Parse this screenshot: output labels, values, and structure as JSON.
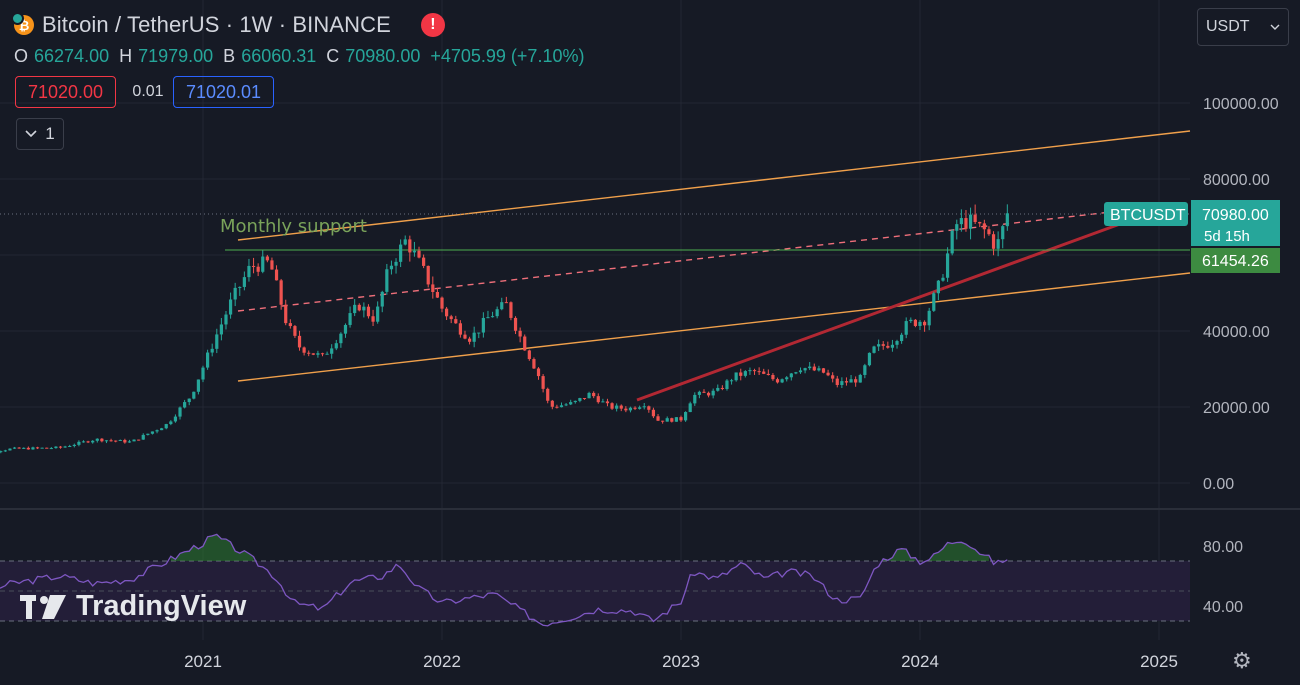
{
  "header": {
    "title": "Bitcoin / TetherUS · 1W · BINANCE",
    "logo_glyph": "₿",
    "alert_glyph": "!",
    "ohlc": [
      {
        "key": "O",
        "value": "66274.00"
      },
      {
        "key": "H",
        "value": "71979.00"
      },
      {
        "key": "B",
        "value": "66060.31"
      },
      {
        "key": "C",
        "value": "70980.00"
      }
    ],
    "change": "+4705.99 (+7.10%)",
    "sell_price": "71020.00",
    "spread": "0.01",
    "buy_price": "71020.01",
    "indicators_count": "1"
  },
  "toolbar": {
    "currency": "USDT"
  },
  "branding": {
    "name": "TradingView"
  },
  "colors": {
    "background": "#161a25",
    "up": "#26a69a",
    "down": "#ef5350",
    "channel": "#f0a04b",
    "trend": "#b22833",
    "support": "#4caf50",
    "rsi": "#7e57c2"
  },
  "chart_data": {
    "type": "candlestick",
    "symbol": "BTCUSDT",
    "last_price": "70980.00",
    "countdown": "5d 15h",
    "support_price": "61454.26",
    "annotation": "Monthly support",
    "ylim": [
      0,
      110000
    ],
    "y_ticks": [
      "100000.00",
      "80000.00",
      "40000.00",
      "20000.00",
      "0.00"
    ],
    "x_ticks": [
      "2021",
      "2022",
      "2023",
      "2024",
      "2025"
    ],
    "weekly_close_path": [
      [
        2020.0,
        7300
      ],
      [
        2020.2,
        9000
      ],
      [
        2020.4,
        9300
      ],
      [
        2020.55,
        11500
      ],
      [
        2020.7,
        10800
      ],
      [
        2020.85,
        15500
      ],
      [
        2020.95,
        23000
      ],
      [
        2021.05,
        38000
      ],
      [
        2021.12,
        48000
      ],
      [
        2021.2,
        57000
      ],
      [
        2021.28,
        58000
      ],
      [
        2021.35,
        42000
      ],
      [
        2021.4,
        36000
      ],
      [
        2021.5,
        33000
      ],
      [
        2021.58,
        40000
      ],
      [
        2021.65,
        47000
      ],
      [
        2021.72,
        43000
      ],
      [
        2021.78,
        57000
      ],
      [
        2021.85,
        64000
      ],
      [
        2021.92,
        56000
      ],
      [
        2022.0,
        46000
      ],
      [
        2022.05,
        42000
      ],
      [
        2022.12,
        38000
      ],
      [
        2022.2,
        44000
      ],
      [
        2022.27,
        47000
      ],
      [
        2022.33,
        38000
      ],
      [
        2022.4,
        29000
      ],
      [
        2022.45,
        20000
      ],
      [
        2022.55,
        21000
      ],
      [
        2022.62,
        23500
      ],
      [
        2022.7,
        20000
      ],
      [
        2022.78,
        19500
      ],
      [
        2022.85,
        21000
      ],
      [
        2022.9,
        16500
      ],
      [
        2023.0,
        16800
      ],
      [
        2023.05,
        23000
      ],
      [
        2023.15,
        24000
      ],
      [
        2023.22,
        28000
      ],
      [
        2023.3,
        29500
      ],
      [
        2023.4,
        27000
      ],
      [
        2023.5,
        30500
      ],
      [
        2023.6,
        29000
      ],
      [
        2023.65,
        26000
      ],
      [
        2023.75,
        27500
      ],
      [
        2023.8,
        35000
      ],
      [
        2023.88,
        37000
      ],
      [
        2023.95,
        42000
      ],
      [
        2024.02,
        43000
      ],
      [
        2024.08,
        52000
      ],
      [
        2024.15,
        68000
      ],
      [
        2024.2,
        69000
      ],
      [
        2024.28,
        66000
      ],
      [
        2024.32,
        62000
      ],
      [
        2024.37,
        70980
      ]
    ],
    "rsi": {
      "ylim": [
        20,
        100
      ],
      "y_ticks": [
        "80.00",
        "40.00"
      ],
      "overbought": 70,
      "oversold": 30,
      "values": [
        [
          2020.0,
          45
        ],
        [
          2020.2,
          55
        ],
        [
          2020.4,
          60
        ],
        [
          2020.55,
          55
        ],
        [
          2020.7,
          58
        ],
        [
          2020.85,
          70
        ],
        [
          2021.0,
          82
        ],
        [
          2021.05,
          87
        ],
        [
          2021.12,
          80
        ],
        [
          2021.2,
          72
        ],
        [
          2021.3,
          60
        ],
        [
          2021.38,
          42
        ],
        [
          2021.5,
          38
        ],
        [
          2021.62,
          56
        ],
        [
          2021.75,
          60
        ],
        [
          2021.82,
          68
        ],
        [
          2021.9,
          52
        ],
        [
          2022.0,
          42
        ],
        [
          2022.1,
          45
        ],
        [
          2022.22,
          48
        ],
        [
          2022.32,
          38
        ],
        [
          2022.42,
          28
        ],
        [
          2022.55,
          33
        ],
        [
          2022.65,
          38
        ],
        [
          2022.8,
          37
        ],
        [
          2022.88,
          30
        ],
        [
          2023.0,
          43
        ],
        [
          2023.05,
          63
        ],
        [
          2023.15,
          58
        ],
        [
          2023.25,
          68
        ],
        [
          2023.35,
          58
        ],
        [
          2023.45,
          63
        ],
        [
          2023.55,
          60
        ],
        [
          2023.65,
          44
        ],
        [
          2023.75,
          45
        ],
        [
          2023.82,
          68
        ],
        [
          2023.92,
          78
        ],
        [
          2024.0,
          70
        ],
        [
          2024.05,
          72
        ],
        [
          2024.12,
          82
        ],
        [
          2024.18,
          85
        ],
        [
          2024.25,
          76
        ],
        [
          2024.32,
          68
        ],
        [
          2024.37,
          72
        ]
      ]
    }
  }
}
